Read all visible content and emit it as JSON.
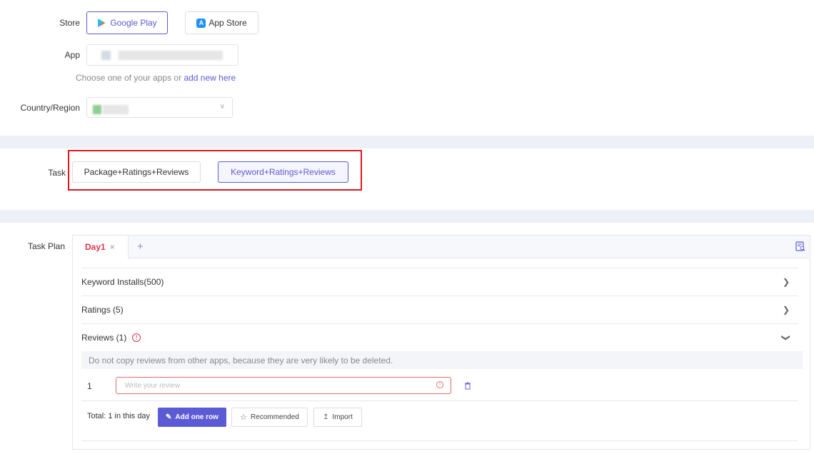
{
  "store": {
    "label": "Store",
    "google_play": "Google Play",
    "app_store": "App Store"
  },
  "app": {
    "label": "App",
    "hint_prefix": "Choose one of your apps or",
    "hint_link": "add new here"
  },
  "country": {
    "label": "Country/Region"
  },
  "task": {
    "label": "Task",
    "option_package": "Package+Ratings+Reviews",
    "option_keyword": "Keyword+Ratings+Reviews",
    "selected": "Keyword+Ratings+Reviews"
  },
  "task_plan": {
    "label": "Task Plan",
    "tab_day": "Day1",
    "tab_close": "×",
    "tab_add": "+",
    "sections": {
      "keyword_installs": "Keyword Installs(500)",
      "ratings": "Ratings (5)",
      "reviews": "Reviews (1)"
    },
    "notice": "Do not copy reviews from other apps, because they are very likely to be deleted.",
    "review_row_number": "1",
    "review_placeholder": "Write your review",
    "total_text": "Total: 1 in this day",
    "add_row_button": "Add one row",
    "recommended_button": "Recommended",
    "import_button": "Import"
  },
  "colors": {
    "accent": "#5b5bd6",
    "highlight_border": "#e5151b",
    "tab_active_text": "#e0364a",
    "error": "#e36a6a",
    "band": "#eef0f7"
  }
}
